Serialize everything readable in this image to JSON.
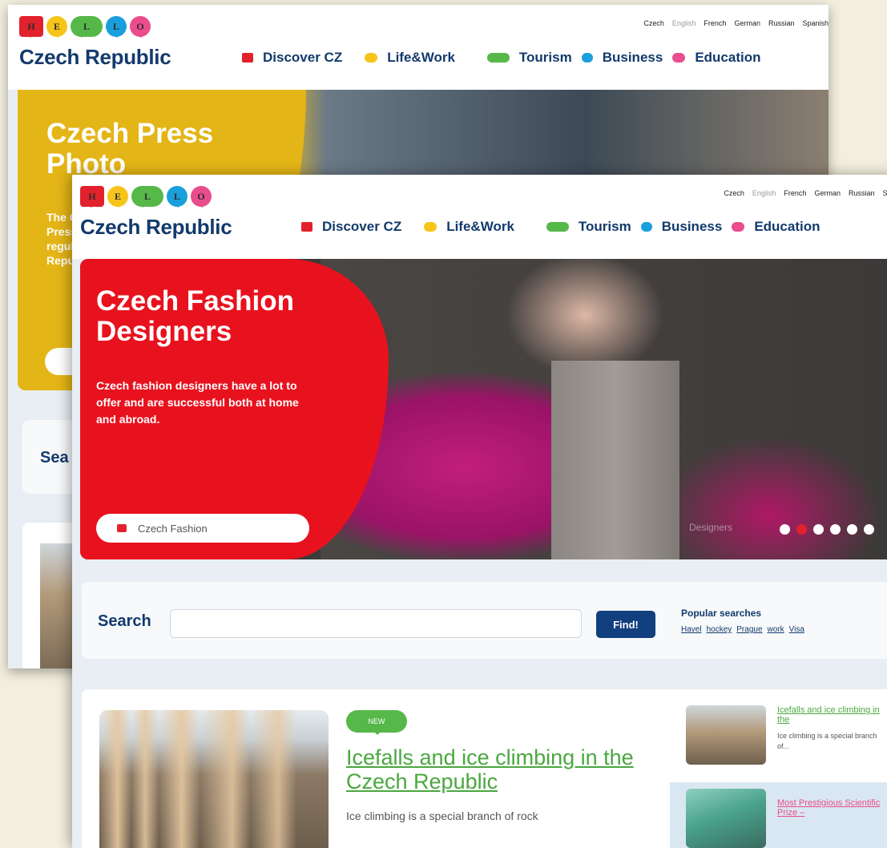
{
  "logo": {
    "letters": [
      "H",
      "E",
      "L",
      "L",
      "O"
    ],
    "title": "Czech Republic"
  },
  "languages": [
    "Czech",
    "English",
    "French",
    "German",
    "Russian",
    "Spanish"
  ],
  "nav": [
    {
      "label": "Discover CZ",
      "color": "#e1222d"
    },
    {
      "label": "Life&Work",
      "color": "#f7c51a"
    },
    {
      "label": "Tourism",
      "color": "#57b84a"
    },
    {
      "label": "Business",
      "color": "#1a9fdd"
    },
    {
      "label": "Education",
      "color": "#e94d8e"
    }
  ],
  "back_page": {
    "hero_title": "Czech Press Photo",
    "hero_desc": "The C Press regul Repu",
    "search_label": "Sea"
  },
  "hero": {
    "title": "Czech Fashion Designers",
    "desc": "Czech fashion designers have a lot to offer and are successful both at home and abroad.",
    "button": "Czech Fashion",
    "caption": "Designers",
    "slides_total": 6,
    "active_slide": 2
  },
  "search": {
    "label": "Search",
    "value": "",
    "button": "Find!",
    "popular_title": "Popular searches",
    "popular": [
      "Havel",
      "hockey",
      "Prague",
      "work",
      "Visa"
    ]
  },
  "article": {
    "badge": "NEW",
    "title": "Icefalls and ice climbing in the Czech Republic",
    "text": "Ice climbing is a special branch of rock"
  },
  "sidebar": [
    {
      "title": "Icefalls and ice climbing in the",
      "text": "Ice climbing is a special branch of..."
    },
    {
      "title": "Most Prestigious Scientific Prize –",
      "text": ""
    }
  ],
  "colors": {
    "brand_navy": "#133a6c",
    "hero_red": "#e8121e",
    "press_yellow": "#e4b516",
    "accent_green": "#57b84a",
    "find_button": "#123f7e"
  }
}
